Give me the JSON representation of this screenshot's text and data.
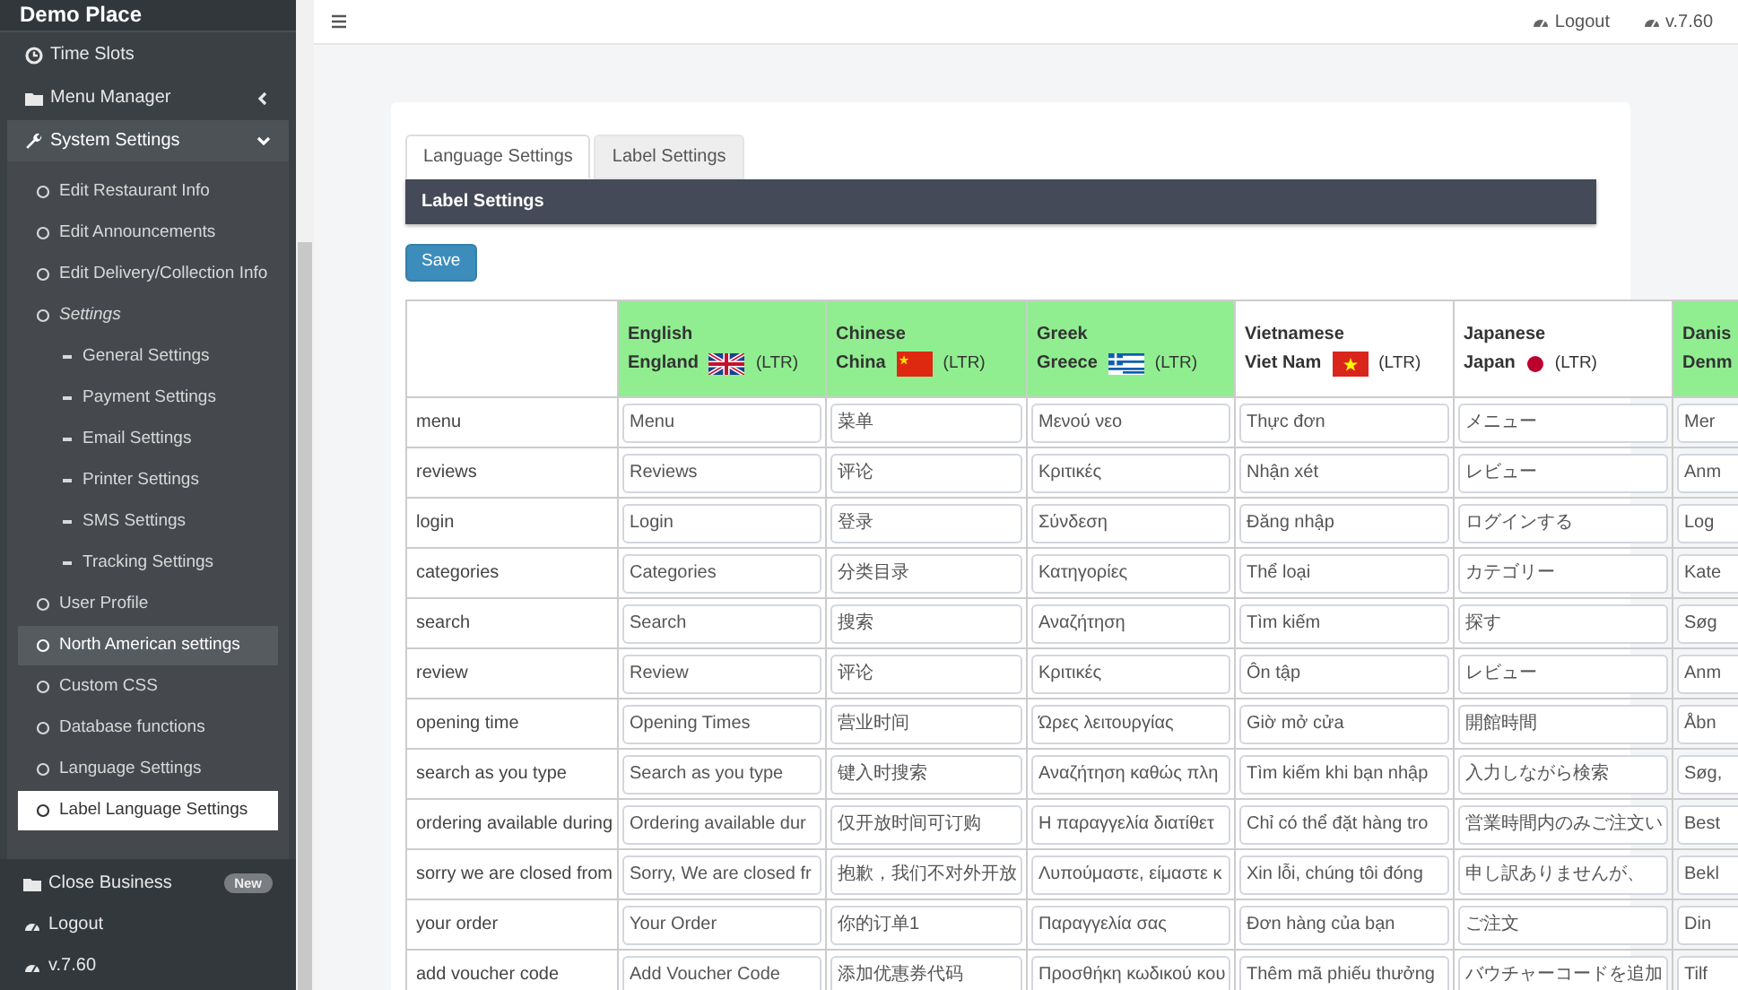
{
  "sidebar": {
    "title": "Demo Place",
    "items": [
      {
        "label": "Time Slots",
        "selected": false
      },
      {
        "label": "Menu Manager",
        "selected": false,
        "expanded": false
      },
      {
        "label": "System Settings",
        "selected": true,
        "expanded": true,
        "children": [
          {
            "label": "Edit Restaurant Info",
            "selected": false,
            "highlighted": false
          },
          {
            "label": "Edit Announcements",
            "selected": false,
            "highlighted": false
          },
          {
            "label": "Edit Delivery/Collection Info",
            "selected": false,
            "highlighted": false
          },
          {
            "label": "Settings",
            "selected": false,
            "highlighted": false,
            "expanded": true,
            "children": [
              {
                "label": "General Settings",
                "selected": false,
                "highlighted": false
              },
              {
                "label": "Payment Settings",
                "selected": false,
                "highlighted": false
              },
              {
                "label": "Email Settings",
                "selected": false,
                "highlighted": false
              },
              {
                "label": "Printer Settings",
                "selected": false,
                "highlighted": false
              },
              {
                "label": "SMS Settings",
                "selected": false,
                "highlighted": false
              },
              {
                "label": "Tracking Settings",
                "selected": false,
                "highlighted": false
              }
            ]
          },
          {
            "label": "User Profile",
            "selected": false,
            "highlighted": false
          },
          {
            "label": "North American settings",
            "selected": false,
            "highlighted": true
          },
          {
            "label": "Custom CSS",
            "selected": false,
            "highlighted": false
          },
          {
            "label": "Database functions",
            "selected": false,
            "highlighted": false
          },
          {
            "label": "Language Settings",
            "selected": false,
            "highlighted": false
          },
          {
            "label": "Label Language Settings",
            "selected": true,
            "highlighted": false
          }
        ]
      }
    ],
    "footer_items": [
      {
        "label": "Close Business",
        "badge": "New"
      },
      {
        "label": "Logout"
      },
      {
        "label": "v.7.60"
      }
    ]
  },
  "topbar": {
    "links": [
      "Logout",
      "v.7.60"
    ]
  },
  "tabs": [
    {
      "label": "Language Settings",
      "selected": true
    },
    {
      "label": "Label Settings",
      "selected": false
    }
  ],
  "panel": {
    "title": "Label Settings",
    "save_button": "Save"
  },
  "table": {
    "columns": [
      {
        "language": "English",
        "country": "England",
        "direction": "(LTR)",
        "highlighted": true
      },
      {
        "language": "Chinese",
        "country": "China",
        "direction": "(LTR)",
        "highlighted": true
      },
      {
        "language": "Greek",
        "country": "Greece",
        "direction": "(LTR)",
        "highlighted": true
      },
      {
        "language": "Vietnamese",
        "country": "Viet Nam",
        "direction": "(LTR)",
        "highlighted": false
      },
      {
        "language": "Japanese",
        "country": "Japan",
        "direction": "(LTR)",
        "highlighted": false
      },
      {
        "language": "Danis",
        "country": "Denm",
        "highlighted": true
      }
    ],
    "rows": [
      {
        "key": "menu",
        "values": [
          "Menu",
          "菜单",
          "Μενού νεο",
          "Thực đơn",
          "メニュー",
          "Mer"
        ]
      },
      {
        "key": "reviews",
        "values": [
          "Reviews",
          "评论",
          "Κριτικές",
          "Nhận xét",
          "レビュー",
          "Anm"
        ]
      },
      {
        "key": "login",
        "values": [
          "Login",
          "登录",
          "Σύνδεση",
          "Đăng nhập",
          "ログインする",
          "Log"
        ]
      },
      {
        "key": "categories",
        "values": [
          "Categories",
          "分类目录",
          "Κατηγορίες",
          "Thể loại",
          "カテゴリー",
          "Kate"
        ]
      },
      {
        "key": "search",
        "values": [
          "Search",
          "搜索",
          "Αναζήτηση",
          "Tìm kiếm",
          "探す",
          "Søg"
        ]
      },
      {
        "key": "review",
        "values": [
          "Review",
          "评论",
          "Κριτικές",
          "Ôn tập",
          "レビュー",
          "Anm"
        ]
      },
      {
        "key": "opening time",
        "values": [
          "Opening Times",
          "营业时间",
          "Ώρες λειτουργίας",
          "Giờ mở cửa",
          "開館時間",
          "Åbn"
        ]
      },
      {
        "key": "search as you type",
        "values": [
          "Search as you type",
          "键入时搜索",
          "Αναζήτηση καθώς πλη",
          "Tìm kiếm khi bạn nhập",
          "入力しながら検索",
          "Søg,"
        ]
      },
      {
        "key": "ordering available during",
        "values": [
          "Ordering available dur",
          "仅开放时间可订购",
          "Η παραγγελία διατίθετ",
          "Chỉ có thể đặt hàng tro",
          "営業時間内のみご注文い",
          "Best"
        ]
      },
      {
        "key": "sorry we are closed from",
        "values": [
          "Sorry, We are closed fr",
          "抱歉，我们不对外开放",
          "Λυπούμαστε, είμαστε κ",
          "Xin lỗi, chúng tôi đóng",
          "申し訳ありませんが、",
          "Bekl"
        ]
      },
      {
        "key": "your order",
        "values": [
          "Your Order",
          "你的订单1",
          "Παραγγελία σας",
          "Đơn hàng của bạn",
          "ご注文",
          "Din"
        ]
      },
      {
        "key": "add voucher code",
        "values": [
          "Add Voucher Code",
          "添加优惠券代码",
          "Προσθήκη κωδικού κου",
          "Thêm mã phiếu thưởng",
          "バウチャーコードを追加",
          "Tilf"
        ]
      }
    ]
  }
}
